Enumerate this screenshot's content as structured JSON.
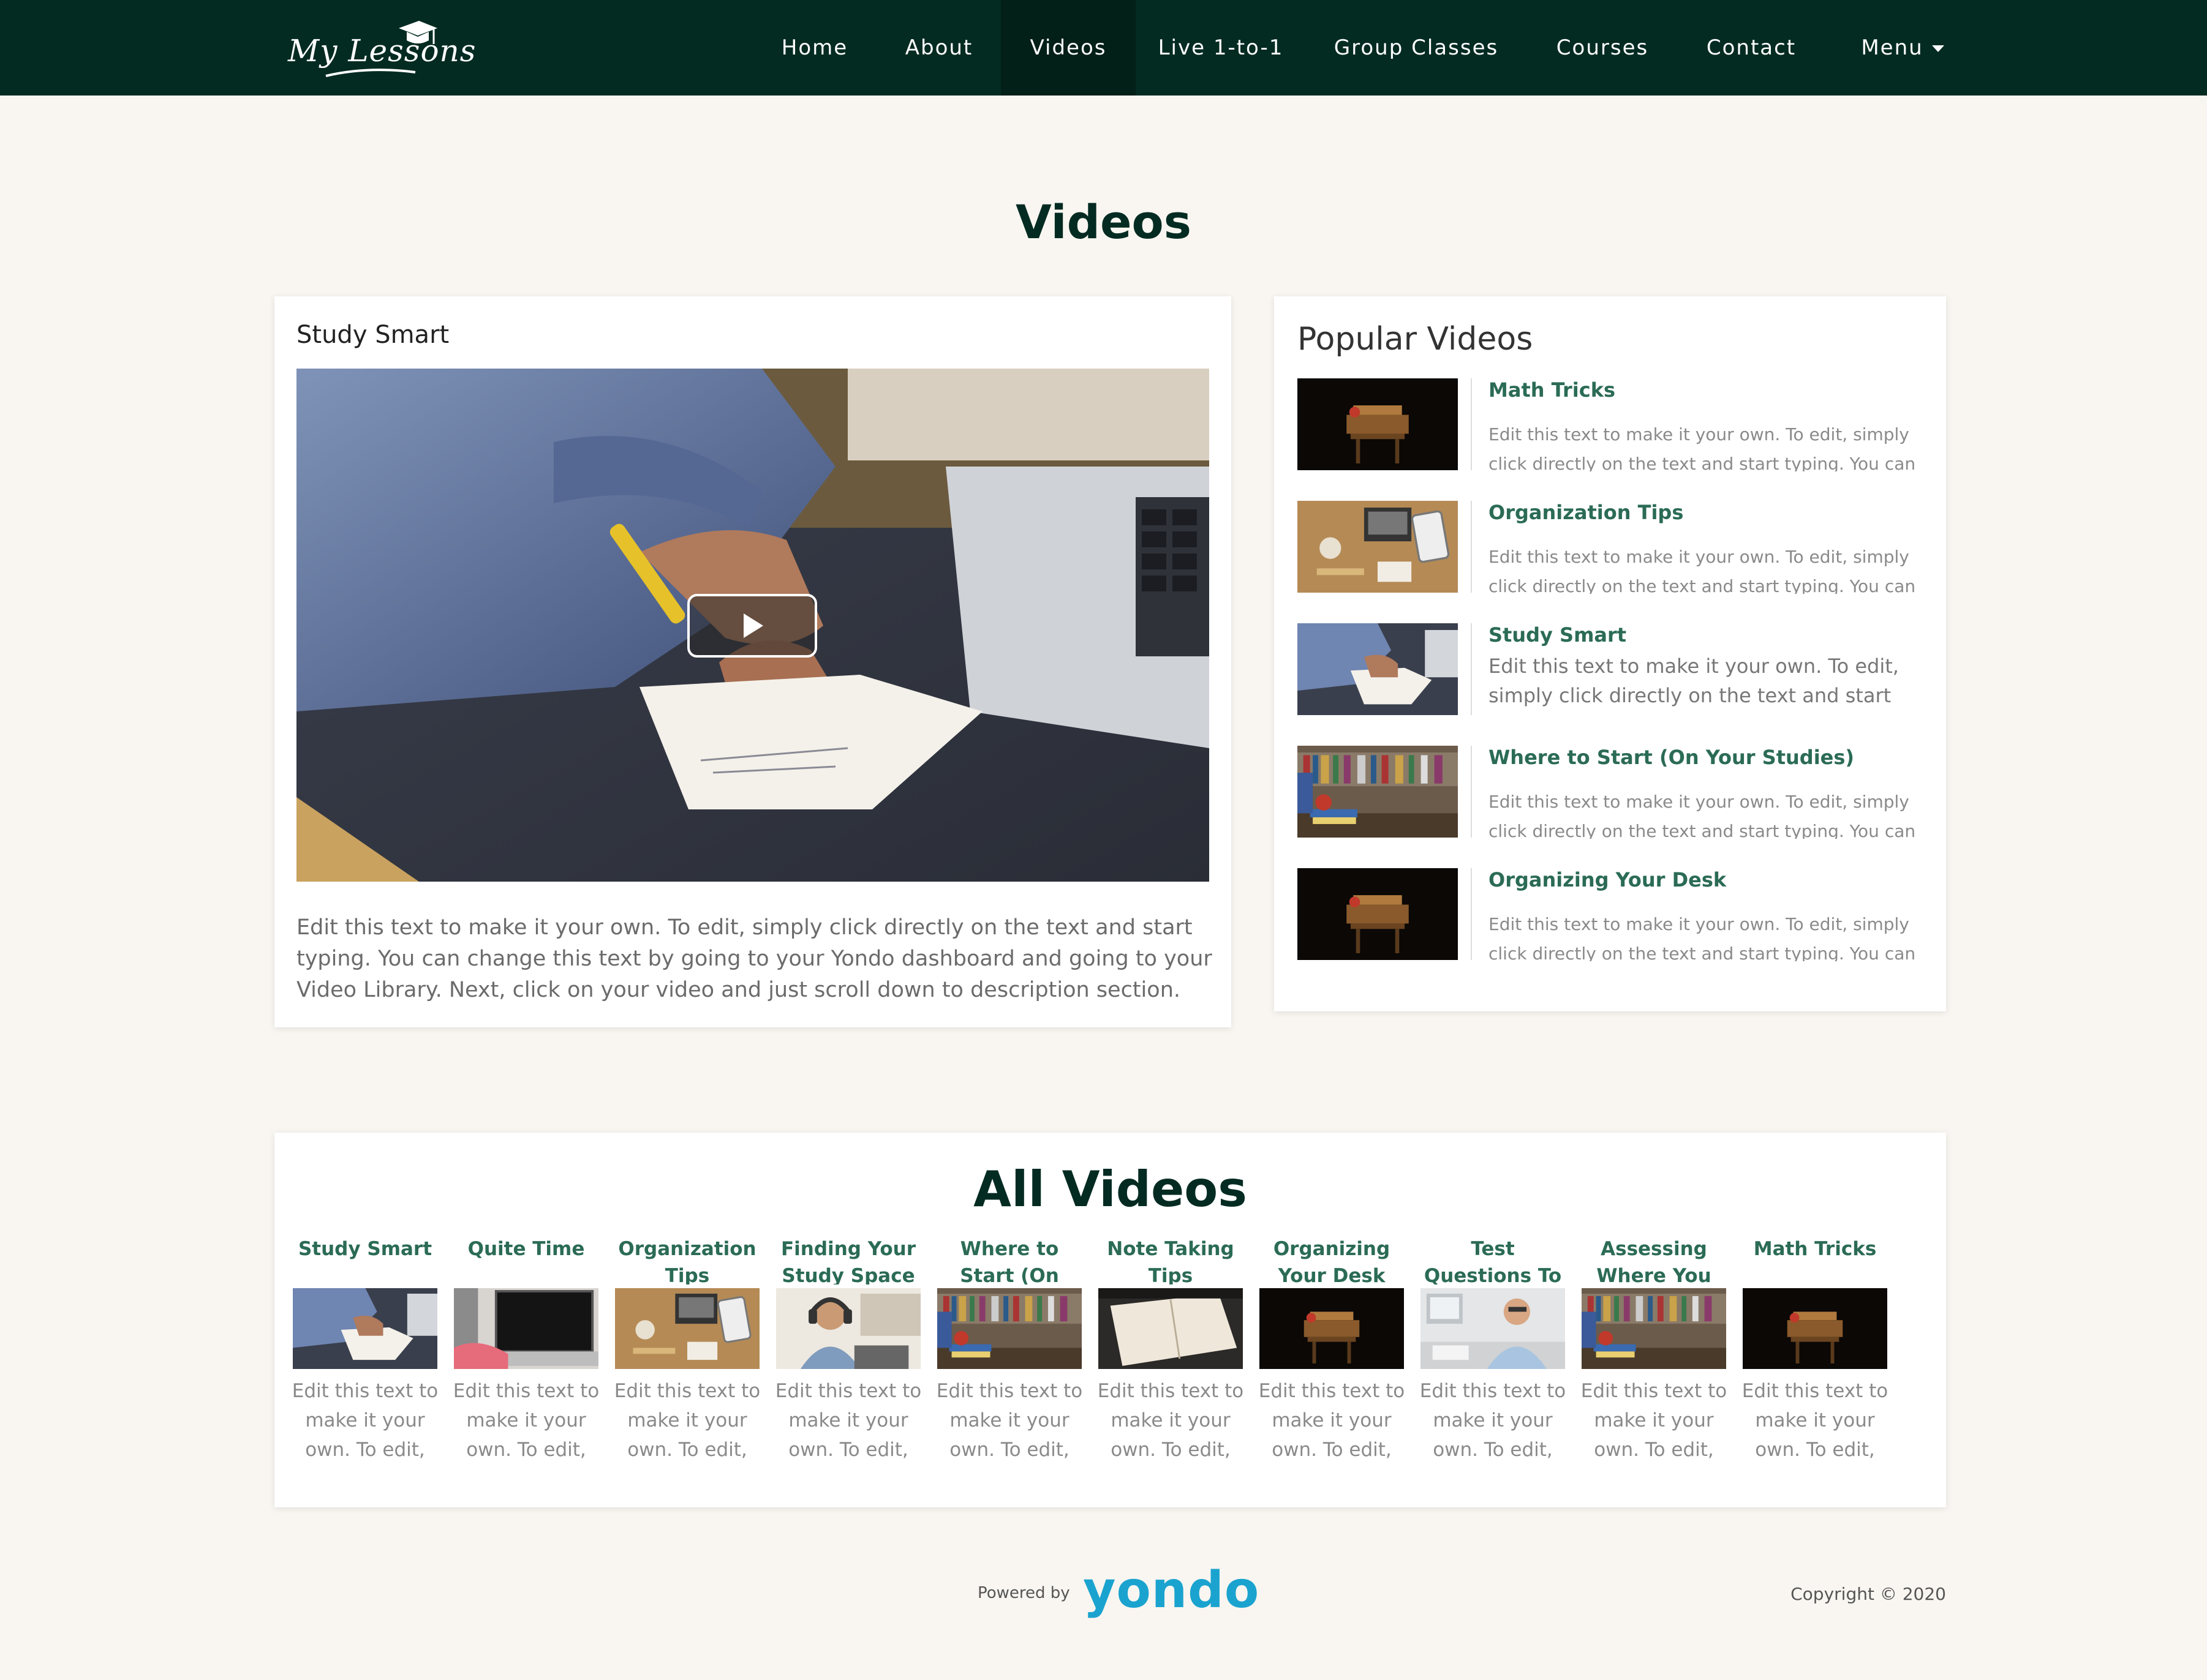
{
  "brand": {
    "logo_text": "My Lessons"
  },
  "nav": {
    "items": [
      {
        "label": "Home"
      },
      {
        "label": "About"
      },
      {
        "label": "Videos"
      },
      {
        "label": "Live 1-to-1"
      },
      {
        "label": "Group Classes"
      },
      {
        "label": "Courses"
      },
      {
        "label": "Contact"
      },
      {
        "label": "Menu"
      }
    ],
    "active": "Videos"
  },
  "page": {
    "title": "Videos"
  },
  "featured": {
    "title": "Study Smart",
    "description": "Edit this text to make it your own. To edit, simply click directly on the text and start typing. You can change this text by going to your Yondo dashboard and going to your Video Library. Next, click on your video and just scroll down to description section."
  },
  "popular": {
    "title": "Popular Videos",
    "items": [
      {
        "title": "Math Tricks",
        "description": "Edit this text to make it your own. To edit, simply click directly on the text and start typing. You can change",
        "thumb": "desk-dark"
      },
      {
        "title": "Organization Tips",
        "description": "Edit this text to make it your own. To edit, simply click directly on the text and start typing. You can change",
        "thumb": "workspace-top"
      },
      {
        "title": "Study Smart",
        "description": "Edit this text to make it your own. To edit, simply click directly on the text and start typing. You can",
        "thumb": "writing"
      },
      {
        "title": "Where to Start (On Your Studies)",
        "description": "Edit this text to make it your own. To edit, simply click directly on the text and start typing. You can change",
        "thumb": "books"
      },
      {
        "title": "Organizing Your Desk",
        "description": "Edit this text to make it your own. To edit, simply click directly on the text and start typing. You can change",
        "thumb": "desk-dark"
      }
    ]
  },
  "all": {
    "title": "All Videos",
    "items": [
      {
        "title": "Study Smart",
        "description": "Edit this text to make it your own. To edit,",
        "thumb": "writing"
      },
      {
        "title": "Quite Time",
        "description": "Edit this text to make it your own. To edit,",
        "thumb": "laptop"
      },
      {
        "title": "Organization Tips",
        "description": "Edit this text to make it your own. To edit,",
        "thumb": "workspace-top"
      },
      {
        "title": "Finding Your Study Space",
        "description": "Edit this text to make it your own. To edit,",
        "thumb": "headphones"
      },
      {
        "title": "Where to Start (On Your...",
        "description": "Edit this text to make it your own. To edit,",
        "thumb": "books"
      },
      {
        "title": "Note Taking Tips",
        "description": "Edit this text to make it your own. To edit,",
        "thumb": "notebook"
      },
      {
        "title": "Organizing Your Desk",
        "description": "Edit this text to make it your own. To edit,",
        "thumb": "desk-dark"
      },
      {
        "title": "Test Questions To Look Out...",
        "description": "Edit this text to make it your own. To edit,",
        "thumb": "office"
      },
      {
        "title": "Assessing Where You Are",
        "description": "Edit this text to make it your own. To edit,",
        "thumb": "books"
      },
      {
        "title": "Math Tricks",
        "description": "Edit this text to make it your own. To edit,",
        "thumb": "desk-dark"
      }
    ]
  },
  "footer": {
    "powered_label": "Powered by",
    "powered_brand": "yondo",
    "copyright": "Copyright © 2020"
  },
  "colors": {
    "nav_bg": "#032b22",
    "accent": "#2b6b56",
    "page_bg": "#f9f6f1",
    "brand_blue": "#1ba3cf"
  }
}
